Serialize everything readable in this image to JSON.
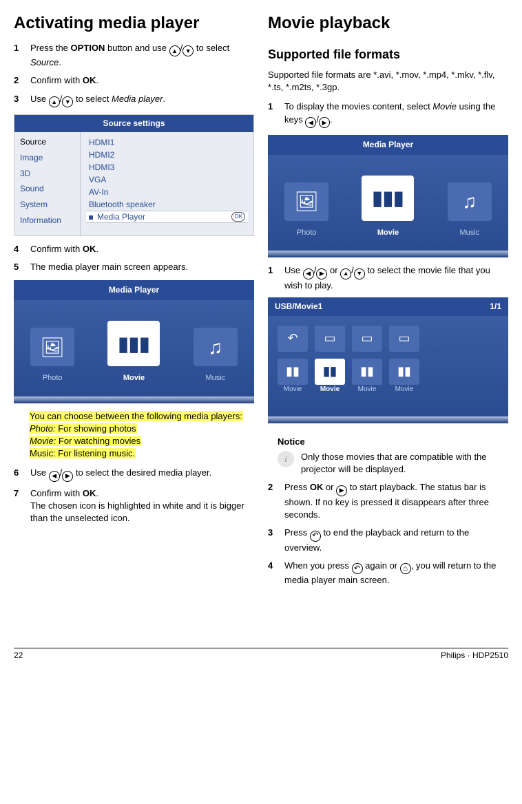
{
  "left": {
    "heading": "Activating media player",
    "steps": {
      "s1a": "Press the ",
      "s1b": "OPTION",
      "s1c": " button and use ",
      "s1d": " to select ",
      "s1e": "Source",
      "s1f": ".",
      "s2a": "Confirm with ",
      "s2b": "OK",
      "s2c": ".",
      "s3a": "Use ",
      "s3b": " to select ",
      "s3c": "Media player",
      "s3d": ".",
      "s4a": "Confirm with ",
      "s4b": "OK",
      "s4c": ".",
      "s5": "The media player main screen appears.",
      "s6a": "Use ",
      "s6b": " to select the desired media player.",
      "s7a": "Confirm with ",
      "s7b": "OK",
      "s7c": ".",
      "s7d": "The chosen icon is highlighted in white and it is bigger than the unselected icon."
    },
    "source_card": {
      "title": "Source settings",
      "left_menu": [
        "Source",
        "Image",
        "3D",
        "Sound",
        "System",
        "Information"
      ],
      "right_items": [
        "HDMI1",
        "HDMI2",
        "HDMI3",
        "VGA",
        "AV-In",
        "Bluetooth speaker",
        "Media Player"
      ],
      "ok_badge": "OK"
    },
    "media_card": {
      "title": "Media Player",
      "items": [
        "Photo",
        "Movie",
        "Music"
      ]
    },
    "highlight": {
      "l1": "You can choose between the following media players:",
      "l2a": "Photo:",
      "l2b": " For showing photos",
      "l3a": "Movie:",
      "l3b": " For watching movies",
      "l4": "Music: For listening music."
    }
  },
  "right": {
    "heading": "Movie playback",
    "subheading": "Supported file formats",
    "formats": "Supported file formats are *.avi, *.mov, *.mp4, *.mkv, *.flv, *.ts, *.m2ts, *.3gp.",
    "steps": {
      "s1a": "To display the movies content, select ",
      "s1b": "Movie",
      "s1c": " using the keys ",
      "s1d": ".",
      "s2a": "Use ",
      "s2b": " or ",
      "s2c": " to select the movie file that you wish to play.",
      "p2a": "Press ",
      "p2b": "OK",
      "p2c": " or ",
      "p2d": " to start playback. The status bar is shown. If no key is pressed it disappears after three seconds.",
      "p3a": "Press ",
      "p3b": " to end the playback and return to the overview.",
      "p4a": "When you press ",
      "p4b": " again or ",
      "p4c": ", you will return to the media player main screen."
    },
    "media_card": {
      "title": "Media Player",
      "items": [
        "Photo",
        "Movie",
        "Music"
      ]
    },
    "file_card": {
      "title": "USB/Movie1",
      "page": "1/1",
      "items": [
        "Movie",
        "Movie",
        "Movie",
        "Movie"
      ]
    },
    "notice": {
      "title": "Notice",
      "text": "Only those movies that are compatible with the projector will be displayed."
    }
  },
  "footer": {
    "page": "22",
    "product": "Philips · HDP2510"
  }
}
